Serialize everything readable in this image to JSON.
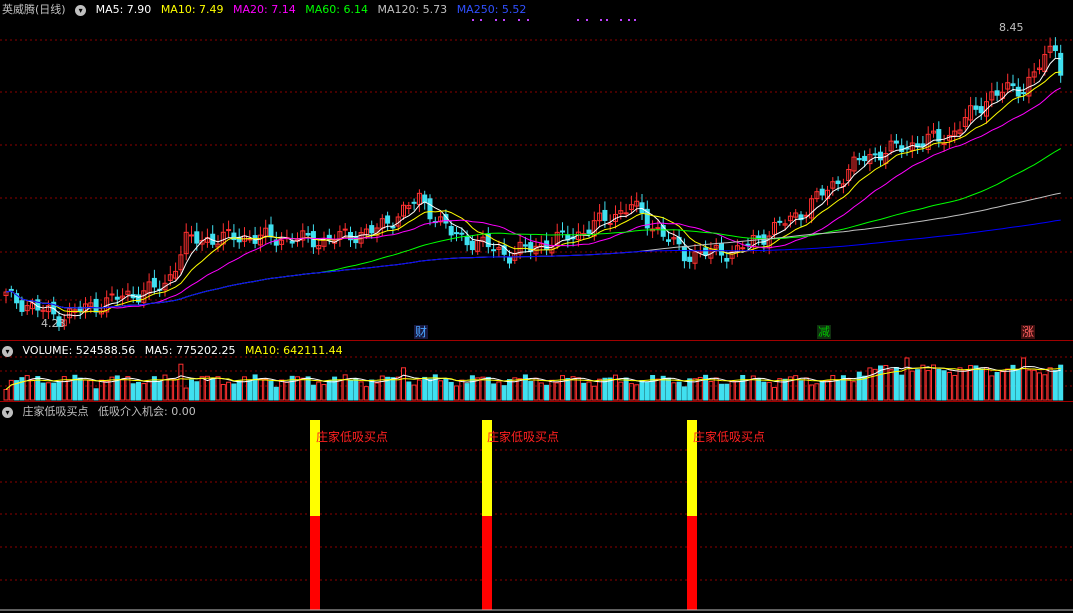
{
  "header": {
    "stock_name": "英威腾(日线)",
    "ma5": "MA5: 7.90",
    "ma10": "MA10: 7.49",
    "ma20": "MA20: 7.14",
    "ma60": "MA60: 6.14",
    "ma120": "MA120: 5.73",
    "ma250": "MA250: 5.52"
  },
  "main_chart": {
    "high_label": "8.45",
    "low_label": "4.23",
    "events": [
      {
        "label": "财",
        "color": "#4aa3ff"
      },
      {
        "label": "减",
        "color": "#00c000"
      },
      {
        "label": "涨",
        "color": "#ff6060"
      }
    ]
  },
  "volume_header": {
    "volume": "VOLUME: 524588.56",
    "ma5": "MA5: 775202.25",
    "ma10": "MA10: 642111.44"
  },
  "indicator_header": {
    "name": "庄家低吸买点",
    "value": "低吸介入机会: 0.00"
  },
  "indicator": {
    "signal_label": "庄家低吸买点",
    "signals": [
      {
        "label": "庄家低吸买点"
      },
      {
        "label": "庄家低吸买点"
      },
      {
        "label": "庄家低吸买点"
      }
    ]
  },
  "colors": {
    "background": "#000000",
    "grid": "#8b0000",
    "ma5": "#ffffff",
    "ma10": "#ffff00",
    "ma20": "#ff00ff",
    "ma60": "#00ff00",
    "ma120": "#c0c0c0",
    "ma250": "#0000ff",
    "up": "#ff3030",
    "down": "#40e0f0"
  },
  "chart_data": {
    "type": "candlestick",
    "title": "英威腾(日线)",
    "y_range": [
      4.23,
      8.45
    ],
    "series": [
      {
        "name": "MA5",
        "last": 7.9
      },
      {
        "name": "MA10",
        "last": 7.49
      },
      {
        "name": "MA20",
        "last": 7.14
      },
      {
        "name": "MA60",
        "last": 6.14
      },
      {
        "name": "MA120",
        "last": 5.73
      },
      {
        "name": "MA250",
        "last": 5.52
      }
    ],
    "volume": {
      "last": 524588.56,
      "ma5": 775202.25,
      "ma10": 642111.44
    },
    "indicator": {
      "name": "庄家低吸买点",
      "value_name": "低吸介入机会",
      "value": 0.0
    }
  }
}
